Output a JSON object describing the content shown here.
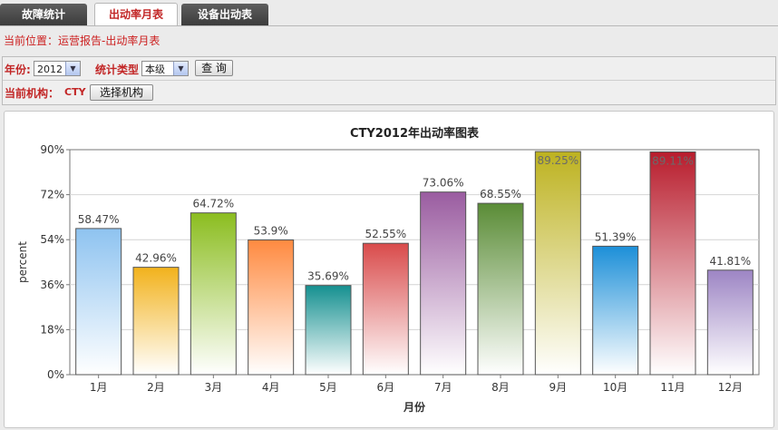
{
  "tabs": [
    {
      "label": "故障统计",
      "active": false
    },
    {
      "label": "出动率月表",
      "active": true
    },
    {
      "label": "设备出动表",
      "active": false
    }
  ],
  "breadcrumb": "当前位置：运营报告-出动率月表",
  "filters": {
    "year_label": "年份:",
    "year_value": "2012",
    "type_label": "统计类型",
    "type_value": "本级",
    "query_button": "查 询",
    "org_label": "当前机构：",
    "org_value": "CTY",
    "select_org_button": "选择机构"
  },
  "chart_data": {
    "type": "bar",
    "title": "CTY2012年出动率图表",
    "xlabel": "月份",
    "ylabel": "percent",
    "ylim": [
      0,
      90
    ],
    "yticks": [
      "0%",
      "18%",
      "36%",
      "54%",
      "72%",
      "90%"
    ],
    "categories": [
      "1月",
      "2月",
      "3月",
      "4月",
      "5月",
      "6月",
      "7月",
      "8月",
      "9月",
      "10月",
      "11月",
      "12月"
    ],
    "values": [
      58.47,
      42.96,
      64.72,
      53.9,
      35.69,
      52.55,
      73.06,
      68.55,
      89.25,
      51.39,
      89.11,
      41.81
    ],
    "value_labels": [
      "58.47%",
      "42.96%",
      "64.72%",
      "53.9%",
      "35.69%",
      "52.55%",
      "73.06%",
      "68.55%",
      "89.25%",
      "51.39%",
      "89.11%",
      "41.81%"
    ],
    "colors": [
      "#8ec3f0",
      "#f2b21c",
      "#8bbd1f",
      "#ff8a40",
      "#159090",
      "#d94b4b",
      "#9a5ca0",
      "#5a8c36",
      "#bdb21f",
      "#1c8fd8",
      "#b81c2c",
      "#9d85c4"
    ],
    "grid": true,
    "legend": "none"
  }
}
